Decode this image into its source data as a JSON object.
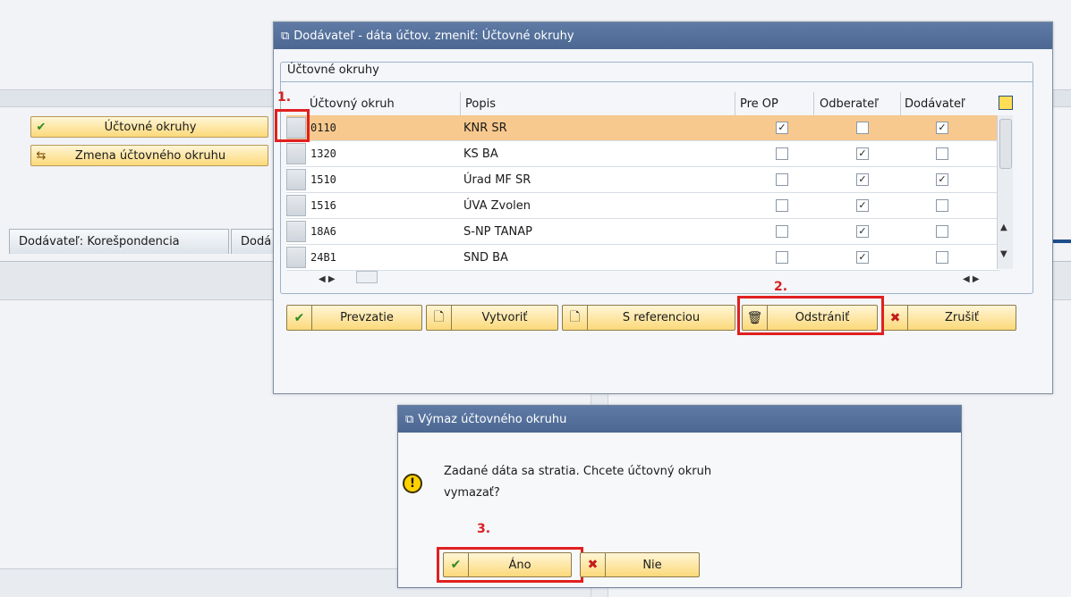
{
  "background": {
    "buttons": [
      {
        "label": "Účtovné okruhy",
        "icon": "checkmark-icon"
      },
      {
        "label": "Zmena účtovného okruhu",
        "icon": "switch-icon"
      }
    ],
    "tabs": [
      {
        "label": "Dodávateľ: Korešpondencia"
      },
      {
        "label": "Dodá"
      }
    ]
  },
  "main_dialog": {
    "title": "Dodávateľ - dáta účtov. zmeniť: Účtovné okruhy",
    "group_title": "Účtovné okruhy",
    "columns": [
      "Účtovný okruh",
      "Popis",
      "Pre OP",
      "Odberateľ",
      "Dodávateľ"
    ],
    "rows": [
      {
        "code": "0110",
        "desc": "KNR SR",
        "pre_op": true,
        "odberatel": false,
        "dodavatel": true,
        "selected": true
      },
      {
        "code": "1320",
        "desc": "KS BA",
        "pre_op": false,
        "odberatel": true,
        "dodavatel": false,
        "selected": false
      },
      {
        "code": "1510",
        "desc": "Úrad MF SR",
        "pre_op": false,
        "odberatel": true,
        "dodavatel": true,
        "selected": false
      },
      {
        "code": "1516",
        "desc": "ÚVA Zvolen",
        "pre_op": false,
        "odberatel": true,
        "dodavatel": false,
        "selected": false
      },
      {
        "code": "18A6",
        "desc": "S-NP TANAP",
        "pre_op": false,
        "odberatel": true,
        "dodavatel": false,
        "selected": false
      },
      {
        "code": "24B1",
        "desc": "SND BA",
        "pre_op": false,
        "odberatel": true,
        "dodavatel": false,
        "selected": false
      }
    ],
    "buttons": {
      "prevzatie": "Prevzatie",
      "vytvorit": "Vytvoriť",
      "s_referenciou": "S referenciou",
      "odstranit": "Odstrániť",
      "zrusit": "Zrušiť"
    }
  },
  "confirm_dialog": {
    "title": "Výmaz účtovného okruhu",
    "message_line1": "Zadané dáta sa stratia. Chcete účtovný okruh",
    "message_line2": "vymazať?",
    "yes_label": "Áno",
    "no_label": "Nie"
  },
  "annotations": {
    "step1": "1.",
    "step2": "2.",
    "step3": "3."
  },
  "colors": {
    "selected_row": "#f7c98e",
    "title_bar": "#4b6792",
    "annotation": "#e02020",
    "button_yellow": "#fcd97a"
  }
}
